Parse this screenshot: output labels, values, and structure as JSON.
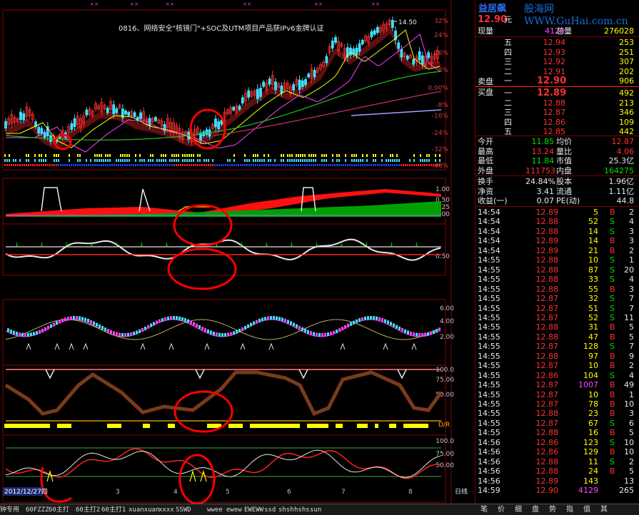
{
  "chart": {
    "headline": "0816、网络安全\"核镜门\"+SOC及UTM项目产品获IPv6金牌认证",
    "high_marker": "14.50",
    "pct_ticks": [
      "32%",
      "24%",
      "16%",
      "8%",
      "0.00%",
      "-8%",
      "-16%",
      "-24%",
      "-32%",
      "-40%"
    ],
    "sub1_ticks": [
      "1.00",
      "0.50",
      "0.25",
      "0.00"
    ],
    "sub2_ticks": [
      "0.50"
    ],
    "sub3_ticks": [
      "6.00",
      "4.00",
      "2.00"
    ],
    "sub4_ticks": [
      "100.0",
      "75.00",
      "50.00"
    ],
    "sub5_ticks": [
      "100.0",
      "75.00",
      "50.00"
    ],
    "sub4_side_label": "D/R",
    "xaxis_date": "2012/12/27四",
    "xaxis_ticks": [
      "3",
      "4",
      "5",
      "6",
      "7",
      "8"
    ],
    "period_label": "日线"
  },
  "quote": {
    "brand": "益居飙",
    "site": "股海网WWW.GuHai.com.cn",
    "price": "12.90",
    "price_unit": "元",
    "now_label": "现量",
    "now_val": "4129",
    "total_label": "总量",
    "total_val": "276028",
    "asks": [
      {
        "label": "五",
        "price": "12.94",
        "vol": "253"
      },
      {
        "label": "四",
        "price": "12.93",
        "vol": "251"
      },
      {
        "label": "三",
        "price": "12.92",
        "vol": "307"
      },
      {
        "label": "二",
        "price": "12.91",
        "vol": "202"
      },
      {
        "label": "一",
        "price": "12.90",
        "vol": "906"
      }
    ],
    "sell_label": "卖盘",
    "buy_label": "买盘",
    "bids": [
      {
        "label": "一",
        "price": "12.89",
        "vol": "492"
      },
      {
        "label": "二",
        "price": "12.88",
        "vol": "213"
      },
      {
        "label": "三",
        "price": "12.87",
        "vol": "346"
      },
      {
        "label": "四",
        "price": "12.86",
        "vol": "109"
      },
      {
        "label": "五",
        "price": "12.85",
        "vol": "442"
      }
    ],
    "stats": [
      {
        "l1": "今开",
        "v1": "11.85",
        "c1": "green",
        "l2": "均价",
        "v2": "12.87",
        "c2": "red"
      },
      {
        "l1": "最高",
        "v1": "13.24",
        "c1": "red",
        "l2": "量比",
        "v2": "4.06",
        "c2": "red"
      },
      {
        "l1": "最低",
        "v1": "11.84",
        "c1": "green",
        "l2": "市值",
        "v2": "25.3亿",
        "c2": "white"
      },
      {
        "l1": "外盘",
        "v1": "111753",
        "c1": "red",
        "l2": "内盘",
        "v2": "164275",
        "c2": "green"
      }
    ],
    "stats2": [
      {
        "l1": "换手",
        "v1": "24.84%",
        "l2": "股本",
        "v2": "1.96亿"
      },
      {
        "l1": "净资",
        "v1": "3.41",
        "l2": "流通",
        "v2": "1.11亿"
      },
      {
        "l1": "收益(一)",
        "v1": "0.07",
        "l2": "PE(动)",
        "v2": "44.8"
      }
    ],
    "ticks": [
      {
        "t": "14:54",
        "p": "12.89",
        "v": "5",
        "s": "B",
        "n": "2"
      },
      {
        "t": "14:54",
        "p": "12.88",
        "v": "52",
        "s": "S",
        "n": "4"
      },
      {
        "t": "14:54",
        "p": "12.88",
        "v": "14",
        "s": "S",
        "n": "3"
      },
      {
        "t": "14:54",
        "p": "12.89",
        "v": "14",
        "s": "B",
        "n": "3"
      },
      {
        "t": "14:54",
        "p": "12.89",
        "v": "21",
        "s": "B",
        "n": "2"
      },
      {
        "t": "14:55",
        "p": "12.88",
        "v": "10",
        "s": "S",
        "n": "1"
      },
      {
        "t": "14:55",
        "p": "12.88",
        "v": "87",
        "s": "S",
        "n": "20"
      },
      {
        "t": "14:55",
        "p": "12.88",
        "v": "33",
        "s": "S",
        "n": "4"
      },
      {
        "t": "14:55",
        "p": "12.88",
        "v": "55",
        "s": "B",
        "n": "3"
      },
      {
        "t": "14:55",
        "p": "12.87",
        "v": "32",
        "s": "S",
        "n": "7"
      },
      {
        "t": "14:55",
        "p": "12.87",
        "v": "51",
        "s": "S",
        "n": "7"
      },
      {
        "t": "14:55",
        "p": "12.87",
        "v": "52",
        "s": "S",
        "n": "11"
      },
      {
        "t": "14:55",
        "p": "12.88",
        "v": "31",
        "s": "B",
        "n": "5"
      },
      {
        "t": "14:55",
        "p": "12.88",
        "v": "47",
        "s": "B",
        "n": "5"
      },
      {
        "t": "14:55",
        "p": "12.87",
        "v": "128",
        "s": "S",
        "n": "7"
      },
      {
        "t": "14:55",
        "p": "12.88",
        "v": "97",
        "s": "B",
        "n": "9"
      },
      {
        "t": "14:55",
        "p": "12.87",
        "v": "10",
        "s": "B",
        "n": "2"
      },
      {
        "t": "14:55",
        "p": "12.86",
        "v": "104",
        "s": "S",
        "n": "4"
      },
      {
        "t": "14:55",
        "p": "12.87",
        "v": "1007",
        "s": "B",
        "n": "49"
      },
      {
        "t": "14:55",
        "p": "12.87",
        "v": "10",
        "s": "B",
        "n": "1"
      },
      {
        "t": "14:55",
        "p": "12.87",
        "v": "78",
        "s": "B",
        "n": "10"
      },
      {
        "t": "14:55",
        "p": "12.88",
        "v": "23",
        "s": "B",
        "n": "3"
      },
      {
        "t": "14:55",
        "p": "12.87",
        "v": "67",
        "s": "S",
        "n": "6"
      },
      {
        "t": "14:55",
        "p": "12.88",
        "v": "16",
        "s": "B",
        "n": "5"
      },
      {
        "t": "14:56",
        "p": "12.86",
        "v": "123",
        "s": "S",
        "n": "10"
      },
      {
        "t": "14:56",
        "p": "12.86",
        "v": "129",
        "s": "B",
        "n": "10"
      },
      {
        "t": "14:56",
        "p": "12.88",
        "v": "11",
        "s": "S",
        "n": "2"
      },
      {
        "t": "14:56",
        "p": "12.88",
        "v": "24",
        "s": "B",
        "n": "5"
      },
      {
        "t": "14:56",
        "p": "12.89",
        "v": "143",
        "s": "",
        "n": "13"
      },
      {
        "t": "14:59",
        "p": "12.90",
        "v": "4129",
        "s": "",
        "n": "265"
      }
    ]
  },
  "bottom_tabs": [
    "钟专用",
    "60FZZZ",
    "60主打",
    "60主打2",
    "60主打1",
    "xuanxuan",
    "xxxx",
    "SSWD",
    "",
    "wwee",
    "ewew",
    "EWEWW",
    "ssd",
    "shsh",
    "hshs",
    "sun"
  ],
  "right_tabs": [
    "笔",
    "价",
    "细",
    "盘",
    "势",
    "指",
    "值",
    "其"
  ]
}
